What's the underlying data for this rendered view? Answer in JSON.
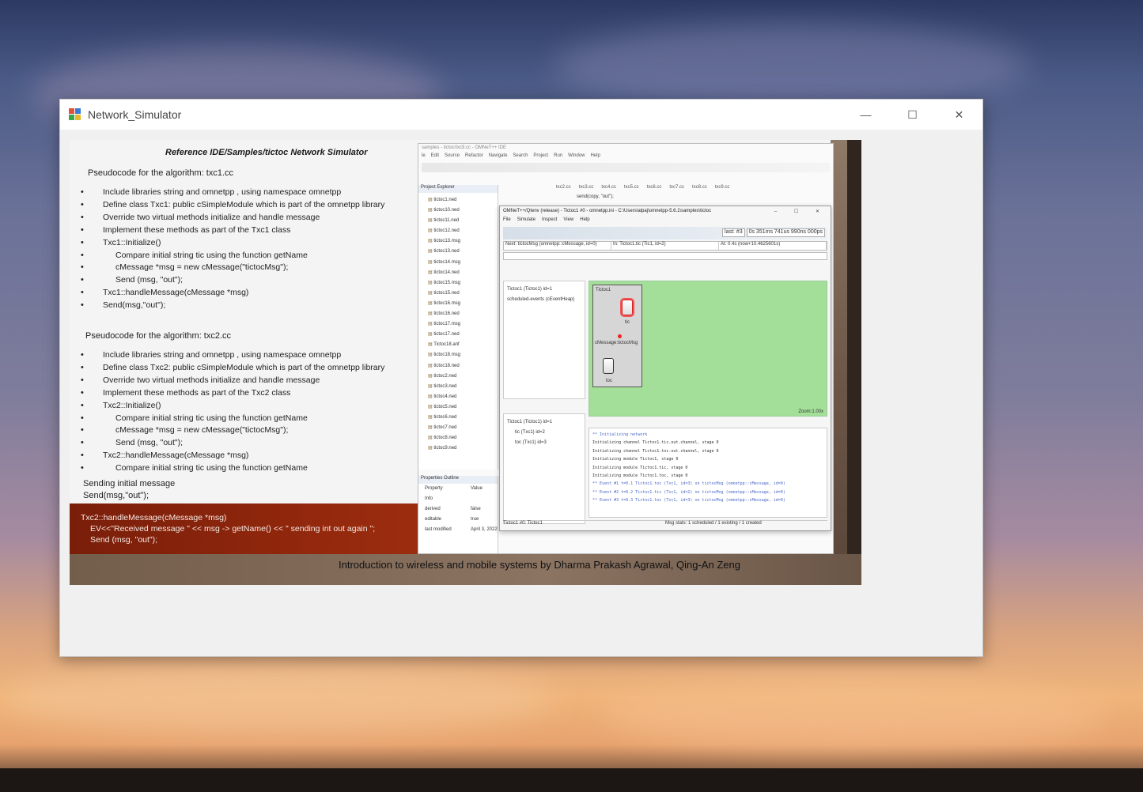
{
  "window": {
    "title": "Network_Simulator",
    "controls": {
      "minimize": "—",
      "maximize": "☐",
      "close": "✕"
    }
  },
  "slide": {
    "heading": "Reference IDE/Samples/tictoc  Network Simulator",
    "section1": {
      "title": "Pseudocode for the algorithm:    txc1.cc",
      "lines": [
        {
          "text": "Include libraries string and omnetpp , using namespace omnetpp",
          "indent": false
        },
        {
          "text": "Define class Txc1: public cSimpleModule which is part of the omnetpp library",
          "indent": false
        },
        {
          "text": "Override two virtual methods initialize and handle message",
          "indent": false
        },
        {
          "text": "Implement these methods as part of the Txc1 class",
          "indent": false
        },
        {
          "text": "Txc1::Initialize()",
          "indent": false
        },
        {
          "text": "Compare initial string tic using the function getName",
          "indent": true
        },
        {
          "text": "cMessage *msg = new cMessage(\"tictocMsg\");",
          "indent": true
        },
        {
          "text": "Send (msg, \"out\");",
          "indent": true
        },
        {
          "text": "Txc1::handleMessage(cMessage *msg)",
          "indent": false
        },
        {
          "text": " Send(msg,\"out\");",
          "indent": false
        }
      ]
    },
    "section2": {
      "title": "Pseudocode for the algorithm:    txc2.cc",
      "lines": [
        {
          "text": "Include libraries string and omnetpp , using namespace omnetpp",
          "indent": false
        },
        {
          "text": "Define class Txc2: public cSimpleModule which is part of the omnetpp library",
          "indent": false
        },
        {
          "text": "Override two virtual methods initialize and handle message",
          "indent": false
        },
        {
          "text": "Implement these methods as part of the Txc2 class",
          "indent": false
        },
        {
          "text": "Txc2::Initialize()",
          "indent": false
        },
        {
          "text": "Compare initial string tic using the function getName",
          "indent": true
        },
        {
          "text": "cMessage *msg = new cMessage(\"tictocMsg\");",
          "indent": true
        },
        {
          "text": "Send (msg, \"out\");",
          "indent": true
        },
        {
          "text": "Txc2::handleMessage(cMessage *msg)",
          "indent": false
        },
        {
          "text": "Compare initial string tic using the function getName",
          "indent": true
        }
      ]
    },
    "sending": {
      "line1": "Sending initial message",
      "line2": " Send(msg,\"out\");"
    },
    "red_band": {
      "line1": "Txc2::handleMessage(cMessage *msg)",
      "line2": "EV<<\"Received message \" << msg -> getName() << \" sending int out again \";",
      "line3": "Send (msg, \"out\");"
    },
    "footer": "Introduction to wireless and mobile systems by Dharma Prakash Agrawal, Qing-An Zeng"
  },
  "ide": {
    "title": "samples - tictoc/txc9.cc - OMNeT++ IDE",
    "menu": [
      "le",
      "Edit",
      "Source",
      "Refactor",
      "Navigate",
      "Search",
      "Project",
      "Run",
      "Window",
      "Help"
    ],
    "explorer_header": "Project Explorer",
    "editor_tabs": [
      "txc2.cc",
      "txc3.cc",
      "txc4.cc",
      "txc5.cc",
      "txc6.cc",
      "txc7.cc",
      "txc8.cc",
      "txc9.cc"
    ],
    "code_line": "send(copy, \"out\");",
    "files": [
      "tictoc1.ned",
      "tictoc10.ned",
      "tictoc11.ned",
      "tictoc12.ned",
      "tictoc13.msg",
      "tictoc13.ned",
      "tictoc14.msg",
      "tictoc14.ned",
      "tictoc15.msg",
      "tictoc15.ned",
      "tictoc16.msg",
      "tictoc16.ned",
      "tictoc17.msg",
      "tictoc17.ned",
      "Tictoc18.anf",
      "tictoc18.msg",
      "tictoc18.ned",
      "tictoc2.ned",
      "tictoc3.ned",
      "tictoc4.ned",
      "tictoc5.ned",
      "tictoc6.ned",
      "tictoc7.ned",
      "tictoc8.ned",
      "tictoc9.ned"
    ],
    "props_header": "Properties  Outline",
    "props_columns": [
      "Property",
      "Value"
    ],
    "props_group": "Info",
    "props_rows": [
      {
        "key": "derived",
        "value": "false"
      },
      {
        "key": "editable",
        "value": "true"
      },
      {
        "key": "last modified",
        "value": "April 3, 2022"
      }
    ]
  },
  "qtenv": {
    "title": "OMNeT++/Qtenv (release) - Tictoc1 #0 - omnetpp.ini - C:\\Users\\alpaj\\omnetpp-5.6.1\\samples\\tictoc",
    "window_ctrls": "–  ☐  ✕",
    "menu": [
      "File",
      "Simulate",
      "Inspect",
      "View",
      "Help"
    ],
    "stats": [
      "last: #3",
      "0s 351ms 741us 990ns 000ps"
    ],
    "info": [
      "Next: tictocMsg (omnetpp::cMessage, id=0)",
      "In: Tictoc1.tic (Tic1, id=2)",
      "At: 0.4s (now+10.4625601s)"
    ],
    "tree": [
      "Tictoc1 (Tictoc1) id=1",
      "scheduled-events (cEventHeap)"
    ],
    "tree2": [
      "Tictoc1 (Tictoc1) id=1",
      "tic (Txc1) id=2",
      "toc (Txc1) id=3"
    ],
    "net_title": "Tictoc1",
    "node_tic": "tic",
    "node_toc": "toc",
    "msg_label": "cMessage:tictocMsg",
    "zoom": "Zoom:1.00x",
    "log": [
      {
        "text": "** Initializing network",
        "cls": "hd"
      },
      {
        "text": "Initializing channel Tictoc1.tic.out.channel, stage 0",
        "cls": ""
      },
      {
        "text": "Initializing channel Tictoc1.toc.out.channel, stage 0",
        "cls": ""
      },
      {
        "text": "Initializing module Tictoc1, stage 0",
        "cls": ""
      },
      {
        "text": "Initializing module Tictoc1.tic, stage 0",
        "cls": ""
      },
      {
        "text": "Initializing module Tictoc1.toc, stage 0",
        "cls": ""
      },
      {
        "text": "** Event #1  t=0.1  Tictoc1.toc (Txc1, id=3)  on tictocMsg (omnetpp::cMessage, id=0)",
        "cls": "ev"
      },
      {
        "text": "** Event #2  t=0.2  Tictoc1.tic (Txc1, id=2)  on tictocMsg (omnetpp::cMessage, id=0)",
        "cls": "ev"
      },
      {
        "text": "** Event #3  t=0.3  Tictoc1.toc (Txc1, id=3)  on tictocMsg (omnetpp::cMessage, id=0)",
        "cls": "ev"
      }
    ],
    "status": [
      "Tictoc1 #0: Tictoc1",
      "Msg stats: 1 scheduled / 1 existing / 1 created"
    ]
  },
  "colors": {
    "titlebar": "#ffffff",
    "window_bg": "#f0f0f0",
    "red_band": "#9c2c0e",
    "net_bg": "#a4df9a"
  }
}
